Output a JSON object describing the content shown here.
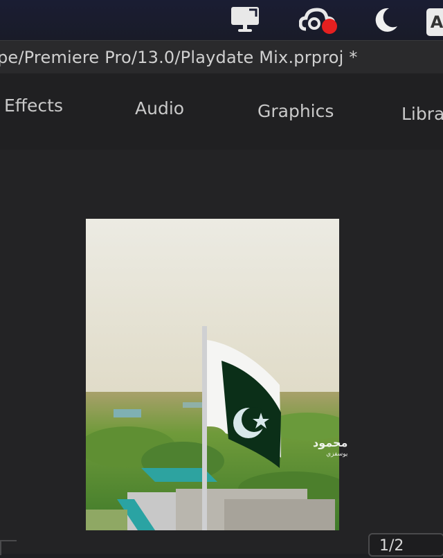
{
  "menubar": {
    "icons": [
      "monitor-icon",
      "creative-cloud-icon",
      "moon-icon",
      "user-icon"
    ],
    "user_initial": "A"
  },
  "titlebar": {
    "path": "pe/Premiere Pro/13.0/Playdate Mix.prproj *"
  },
  "workspace_tabs": [
    {
      "label": "Effects"
    },
    {
      "label": "Audio"
    },
    {
      "label": "Graphics"
    },
    {
      "label": "Libra"
    }
  ],
  "program_monitor": {
    "watermark_line1": "محمود",
    "watermark_line2": "يوسفزي",
    "page_indicator": "1/2"
  },
  "colors": {
    "accent_red": "#e52020",
    "flag_green": "#0b3d1c"
  }
}
